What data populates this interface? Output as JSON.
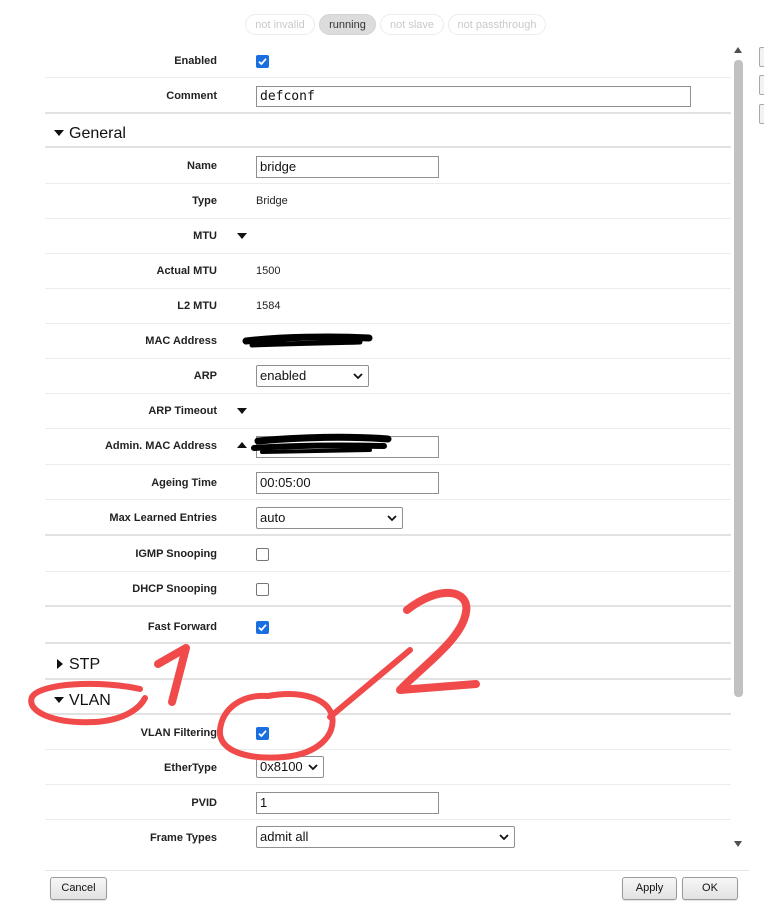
{
  "status_pills": [
    {
      "label": "not invalid",
      "active": false
    },
    {
      "label": "running",
      "active": true
    },
    {
      "label": "not slave",
      "active": false
    },
    {
      "label": "not passthrough",
      "active": false
    }
  ],
  "top_fields": {
    "enabled": {
      "label": "Enabled",
      "checked": true
    },
    "comment": {
      "label": "Comment",
      "value": "defconf"
    }
  },
  "sections": {
    "general": {
      "title": "General",
      "expanded": true
    },
    "stp": {
      "title": "STP",
      "expanded": false
    },
    "vlan": {
      "title": "VLAN",
      "expanded": true
    }
  },
  "general": {
    "name": {
      "label": "Name",
      "value": "bridge"
    },
    "type": {
      "label": "Type",
      "value": "Bridge"
    },
    "mtu": {
      "label": "MTU"
    },
    "actual_mtu": {
      "label": "Actual MTU",
      "value": "1500"
    },
    "l2_mtu": {
      "label": "L2 MTU",
      "value": "1584"
    },
    "mac_address": {
      "label": "MAC Address",
      "value": ""
    },
    "arp": {
      "label": "ARP",
      "value": "enabled"
    },
    "arp_timeout": {
      "label": "ARP Timeout"
    },
    "admin_mac": {
      "label": "Admin. MAC Address",
      "value": ""
    },
    "ageing_time": {
      "label": "Ageing Time",
      "value": "00:05:00"
    },
    "max_learned": {
      "label": "Max Learned Entries",
      "value": "auto"
    },
    "igmp_snooping": {
      "label": "IGMP Snooping",
      "checked": false
    },
    "dhcp_snooping": {
      "label": "DHCP Snooping",
      "checked": false
    },
    "fast_forward": {
      "label": "Fast Forward",
      "checked": true
    }
  },
  "vlan": {
    "vlan_filtering": {
      "label": "VLAN Filtering",
      "checked": true
    },
    "ethertype": {
      "label": "EtherType",
      "value": "0x8100"
    },
    "pvid": {
      "label": "PVID",
      "value": "1"
    },
    "frame_types": {
      "label": "Frame Types",
      "value": "admit all"
    }
  },
  "footer": {
    "cancel": "Cancel",
    "apply": "Apply",
    "ok": "OK"
  },
  "annotations": {
    "mark_1": "1",
    "mark_2": "2",
    "color": "#f04a4a"
  },
  "colors": {
    "checkbox": "#1a6fe0",
    "pill_active": "#dcdcdc",
    "redaction": "#000000"
  }
}
